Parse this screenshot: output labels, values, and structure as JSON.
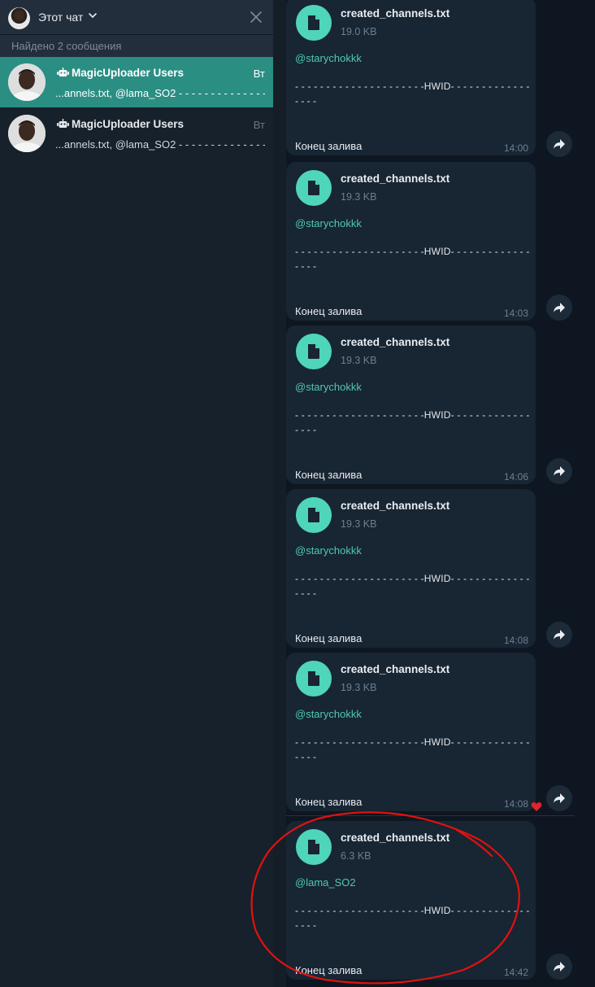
{
  "search": {
    "scope_label": "Этот чат",
    "found_label": "Найдено 2 сообщения"
  },
  "results": [
    {
      "name": "MagicUploader Users",
      "day": "Вт",
      "snippet": "...annels.txt, @lama_SO2 - - - - - - - - - - - - - - - - - - - - -...",
      "active": true
    },
    {
      "name": "MagicUploader Users",
      "day": "Вт",
      "snippet": "...annels.txt, @lama_SO2 - - - - - - - - - - - - - - - - - - - - -...",
      "active": false
    }
  ],
  "messages": [
    {
      "file_name": "created_channels.txt",
      "file_size": "19.0 KB",
      "mention": "@starychokkk",
      "hwid_line1": "- - - - - - - - - - - - - - - - - - - - -HWID- - - - - - - - - - - - - - - - -",
      "hwid_line2": "- - - -",
      "end_text": "Конец залива",
      "time": "14:00"
    },
    {
      "file_name": "created_channels.txt",
      "file_size": "19.3 KB",
      "mention": "@starychokkk",
      "hwid_line1": "- - - - - - - - - - - - - - - - - - - - -HWID- - - - - - - - - - - - - - - - -",
      "hwid_line2": "- - - -",
      "end_text": "Конец залива",
      "time": "14:03"
    },
    {
      "file_name": "created_channels.txt",
      "file_size": "19.3 KB",
      "mention": "@starychokkk",
      "hwid_line1": "- - - - - - - - - - - - - - - - - - - - -HWID- - - - - - - - - - - - - - - - -",
      "hwid_line2": "- - - -",
      "end_text": "Конец залива",
      "time": "14:06"
    },
    {
      "file_name": "created_channels.txt",
      "file_size": "19.3 KB",
      "mention": "@starychokkk",
      "hwid_line1": "- - - - - - - - - - - - - - - - - - - - -HWID- - - - - - - - - - - - - - - - -",
      "hwid_line2": "- - - -",
      "end_text": "Конец залива",
      "time": "14:08"
    },
    {
      "file_name": "created_channels.txt",
      "file_size": "19.3 KB",
      "mention": "@starychokkk",
      "hwid_line1": "- - - - - - - - - - - - - - - - - - - - -HWID- - - - - - - - - - - - - - - - -",
      "hwid_line2": "- - - -",
      "end_text": "Конец залива",
      "time": "14:08"
    },
    {
      "file_name": "created_channels.txt",
      "file_size": "6.3 KB",
      "mention": "@lama_SO2",
      "hwid_line1": "- - - - - - - - - - - - - - - - - - - - -HWID- - - - - - - - - - - - - - - - -",
      "hwid_line2": "- - - -",
      "end_text": "Конец залива",
      "time": "14:42"
    }
  ],
  "colors": {
    "accent": "#2b8e83",
    "file_icon": "#4fd5b9",
    "mention": "#4ec9b0",
    "annotation": "#e0120f",
    "reaction": "#e0242d"
  },
  "icons": {
    "header": [
      "avatar",
      "chevron-down-icon",
      "close-icon"
    ],
    "result": [
      "bot-icon"
    ],
    "message": [
      "file-icon",
      "forward-icon"
    ],
    "reaction": "heart-icon"
  }
}
